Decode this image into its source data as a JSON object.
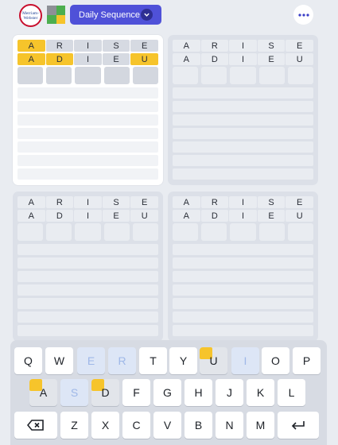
{
  "header": {
    "logo_line1": "Merriam-",
    "logo_line2": "Webster",
    "mode_label": "Daily Sequence",
    "icons": {
      "logo": "mw-logo-icon",
      "app": "quordle-icon",
      "dropdown": "chevron-down-icon",
      "more": "more-dots-icon"
    },
    "colors": {
      "accent": "#4f51d8",
      "present": "#f6c42b",
      "absent": "#d6dae2"
    }
  },
  "boards": [
    {
      "active": true,
      "rows": [
        {
          "letters": [
            "A",
            "R",
            "I",
            "S",
            "E"
          ],
          "states": [
            "present",
            "absent",
            "absent",
            "absent",
            "absent"
          ]
        },
        {
          "letters": [
            "A",
            "D",
            "I",
            "E",
            "U"
          ],
          "states": [
            "present",
            "present",
            "absent",
            "absent",
            "present"
          ]
        }
      ],
      "empty_rows": 7
    },
    {
      "active": false,
      "rows": [
        {
          "letters": [
            "A",
            "R",
            "I",
            "S",
            "E"
          ],
          "states": [
            "none",
            "none",
            "none",
            "none",
            "none"
          ]
        },
        {
          "letters": [
            "A",
            "D",
            "I",
            "E",
            "U"
          ],
          "states": [
            "none",
            "none",
            "none",
            "none",
            "none"
          ]
        }
      ],
      "empty_rows": 7
    },
    {
      "active": false,
      "rows": [
        {
          "letters": [
            "A",
            "R",
            "I",
            "S",
            "E"
          ],
          "states": [
            "none",
            "none",
            "none",
            "none",
            "none"
          ]
        },
        {
          "letters": [
            "A",
            "D",
            "I",
            "E",
            "U"
          ],
          "states": [
            "none",
            "none",
            "none",
            "none",
            "none"
          ]
        }
      ],
      "empty_rows": 7
    },
    {
      "active": false,
      "rows": [
        {
          "letters": [
            "A",
            "R",
            "I",
            "S",
            "E"
          ],
          "states": [
            "none",
            "none",
            "none",
            "none",
            "none"
          ]
        },
        {
          "letters": [
            "A",
            "D",
            "I",
            "E",
            "U"
          ],
          "states": [
            "none",
            "none",
            "none",
            "none",
            "none"
          ]
        }
      ],
      "empty_rows": 7
    }
  ],
  "keyboard": {
    "row1": [
      {
        "label": "Q",
        "state": "normal"
      },
      {
        "label": "W",
        "state": "normal"
      },
      {
        "label": "E",
        "state": "faint"
      },
      {
        "label": "R",
        "state": "faint"
      },
      {
        "label": "T",
        "state": "normal"
      },
      {
        "label": "Y",
        "state": "normal"
      },
      {
        "label": "U",
        "state": "present"
      },
      {
        "label": "I",
        "state": "faint"
      },
      {
        "label": "O",
        "state": "normal"
      },
      {
        "label": "P",
        "state": "normal"
      }
    ],
    "row2": [
      {
        "label": "A",
        "state": "present"
      },
      {
        "label": "S",
        "state": "faint"
      },
      {
        "label": "D",
        "state": "present"
      },
      {
        "label": "F",
        "state": "normal"
      },
      {
        "label": "G",
        "state": "normal"
      },
      {
        "label": "H",
        "state": "normal"
      },
      {
        "label": "J",
        "state": "normal"
      },
      {
        "label": "K",
        "state": "normal"
      },
      {
        "label": "L",
        "state": "normal"
      }
    ],
    "row3": [
      {
        "label": "",
        "state": "backspace",
        "icon": "backspace-icon"
      },
      {
        "label": "Z",
        "state": "normal"
      },
      {
        "label": "X",
        "state": "normal"
      },
      {
        "label": "C",
        "state": "normal"
      },
      {
        "label": "V",
        "state": "normal"
      },
      {
        "label": "B",
        "state": "normal"
      },
      {
        "label": "N",
        "state": "normal"
      },
      {
        "label": "M",
        "state": "normal"
      },
      {
        "label": "",
        "state": "enter",
        "icon": "enter-icon"
      }
    ]
  }
}
